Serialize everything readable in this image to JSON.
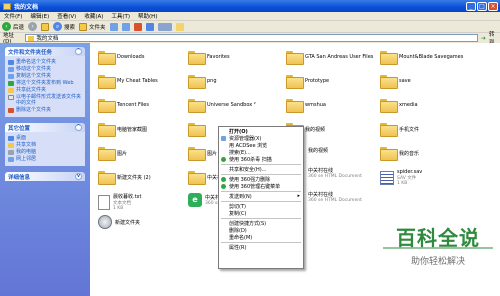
{
  "window": {
    "title": "我的文档"
  },
  "menubar": [
    "文件(F)",
    "编辑(E)",
    "查看(V)",
    "收藏(A)",
    "工具(T)",
    "帮助(H)"
  ],
  "toolbar": {
    "back": "后退",
    "search": "搜索",
    "folders": "文件夹"
  },
  "address": {
    "label": "地址(D)",
    "value": "我的文档",
    "go": "转到"
  },
  "tasks": {
    "head": "文件和文件夹任务",
    "items": [
      "重命名这个文件夹",
      "移动这个文件夹",
      "复制这个文件夹",
      "将这个文件夹发布到 Web",
      "共享此文件夹",
      "以电子邮件形式发送该文件夹中的文件",
      "删除这个文件夹"
    ]
  },
  "places": {
    "head": "其它位置",
    "items": [
      "桌面",
      "共享文档",
      "我的电脑",
      "网上邻居"
    ]
  },
  "details": {
    "head": "详细信息"
  },
  "files": [
    {
      "label": "Downloads"
    },
    {
      "label": "Favorites"
    },
    {
      "label": "GTA San Andreas User Files"
    },
    {
      "label": "Mount&Blade Savegames"
    },
    {
      "label": "My Cheat Tables"
    },
    {
      "label": "png"
    },
    {
      "label": "Prototype"
    },
    {
      "label": "save"
    },
    {
      "label": "Tencent Files"
    },
    {
      "label": "Universe Sandbox ²"
    },
    {
      "label": "wmshua"
    },
    {
      "label": "xmedia"
    },
    {
      "label": "电脑管家截图"
    },
    {
      "label": "我的视频"
    },
    {
      "label": "手机文件"
    },
    {
      "label": "图片"
    },
    {
      "label": "图片"
    },
    {
      "label": "我的视频"
    },
    {
      "label": "我的音乐"
    },
    {
      "label": "新建文件夹 (2)"
    },
    {
      "label": "中关村在线"
    },
    {
      "label": "中关村在线"
    },
    {
      "label": "中关村在线"
    },
    {
      "label": "新建文件夹"
    }
  ],
  "docs": [
    {
      "name": "晨收暮收.txt",
      "type": "文本文档",
      "size": "1 KB"
    },
    {
      "name": "中关村在线",
      "type": "360 se HTML Document",
      "size": ""
    },
    {
      "name": "中关村在线",
      "type": "360 se HTML Document",
      "size": ""
    },
    {
      "name": "中关村在线",
      "type": "360 se HTML Document",
      "size": ""
    },
    {
      "name": "spider.sav",
      "type": "SAV 文件",
      "size": "1 KB"
    }
  ],
  "docs_note": "中关村在线 — 中关村在线 — ...",
  "context_menu": [
    {
      "label": "打开(O)",
      "bold": true
    },
    {
      "label": "资源管理器(X)"
    },
    {
      "label": "用 ACDSee 浏览"
    },
    {
      "label": "搜索(E)..."
    },
    {
      "label": "使用 360杀毒 扫描"
    },
    {
      "sep": true
    },
    {
      "label": "共享和安全(H)..."
    },
    {
      "sep": true
    },
    {
      "label": "使用 360强力删除"
    },
    {
      "label": "使用 360管理右键菜单"
    },
    {
      "sep": true
    },
    {
      "label": "发送到(N)",
      "arrow": "▸"
    },
    {
      "sep": true
    },
    {
      "label": "剪切(T)"
    },
    {
      "label": "复制(C)"
    },
    {
      "sep": true
    },
    {
      "label": "创建快捷方式(S)"
    },
    {
      "label": "删除(D)"
    },
    {
      "label": "重命名(M)"
    },
    {
      "sep": true
    },
    {
      "label": "属性(R)"
    }
  ],
  "watermark": {
    "title": "百科全说",
    "subtitle": "助你轻松解决"
  },
  "colors": {
    "accent": "#316ac5",
    "titlebar": "#0a4fd6",
    "brand_green": "#2f8a3e"
  }
}
